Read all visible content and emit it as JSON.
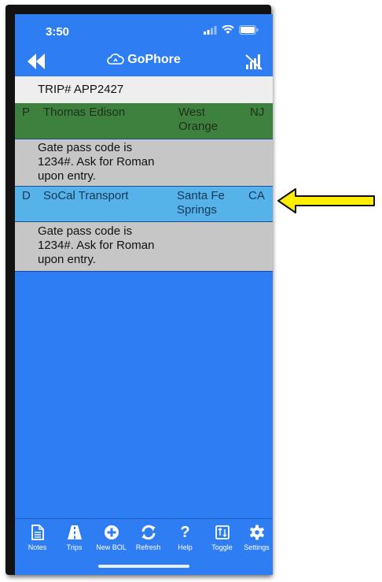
{
  "status_bar": {
    "time": "3:50"
  },
  "app": {
    "title": "GoPhore"
  },
  "trip": {
    "header": "TRIP# APP2427"
  },
  "stops": [
    {
      "type": "P",
      "name": "Thomas Edison",
      "city_line1": "West",
      "city_line2": "Orange",
      "state": "NJ",
      "note_lines": [
        "Gate pass code is",
        "1234#. Ask for Roman",
        "upon entry."
      ],
      "color": "#3e813f"
    },
    {
      "type": "D",
      "name": "SoCal Transport",
      "city_line1": "Santa Fe",
      "city_line2": "Springs",
      "state": "CA",
      "note_lines": [
        "Gate pass code is",
        "1234#. Ask for Roman",
        "upon entry."
      ],
      "color": "#55b3e9"
    }
  ],
  "tabbar": {
    "items": [
      {
        "label": "Notes",
        "icon": "notes-icon"
      },
      {
        "label": "Trips",
        "icon": "road-icon"
      },
      {
        "label": "New BOL",
        "icon": "plus-circle-icon"
      },
      {
        "label": "Refresh",
        "icon": "refresh-icon"
      },
      {
        "label": "Help",
        "icon": "question-icon"
      },
      {
        "label": "Toggle",
        "icon": "toggle-icon"
      },
      {
        "label": "Settings",
        "icon": "gear-icon"
      }
    ]
  },
  "colors": {
    "primary": "#2f7df3",
    "annotation_arrow": "#ffee00"
  }
}
